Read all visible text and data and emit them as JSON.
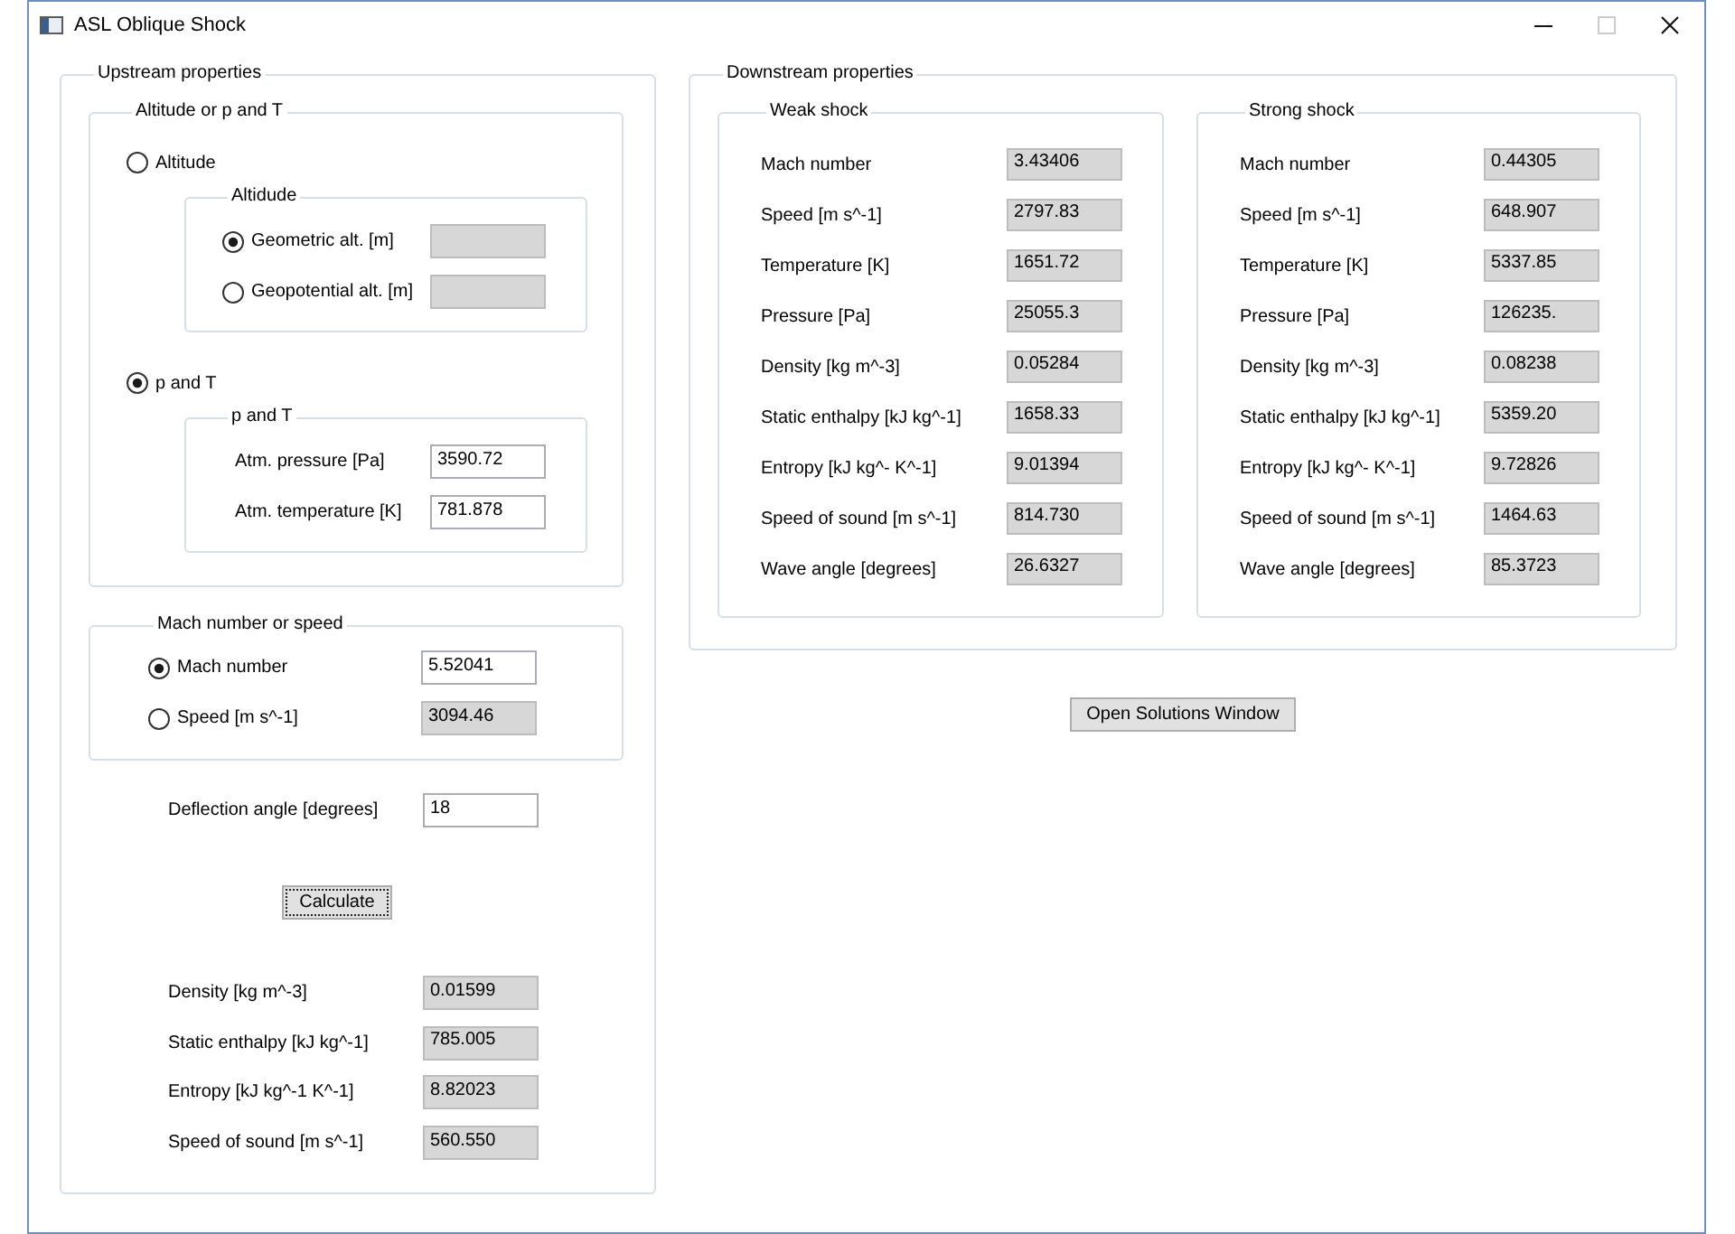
{
  "window": {
    "title": "ASL Oblique Shock",
    "maximize_disabled": true
  },
  "upstream": {
    "title": "Upstream properties",
    "source": {
      "title": "Altitude or p and T",
      "options": [
        {
          "label": "Altitude",
          "selected": false,
          "group": {
            "title": "Altidude",
            "rows": [
              {
                "kind": "radio",
                "label": "Geometric alt. [m]",
                "selected": true,
                "disabled": true
              },
              {
                "kind": "radio",
                "label": "Geopotential alt. [m]",
                "selected": false,
                "disabled": true
              }
            ]
          }
        },
        {
          "label": "p and T",
          "selected": true,
          "group": {
            "title": "p and T",
            "rows": [
              {
                "kind": "field",
                "label": "Atm. pressure [Pa]",
                "value": "3590.72",
                "disabled": false
              },
              {
                "kind": "field",
                "label": "Atm. temperature [K]",
                "value": "781.878",
                "disabled": false
              }
            ]
          }
        }
      ]
    },
    "motion": {
      "title": "Mach number or speed",
      "options": [
        {
          "label": "Mach number",
          "selected": true,
          "value": "5.52041",
          "disabled": false
        },
        {
          "label": "Speed [m s^-1]",
          "selected": false,
          "value": "3094.46",
          "disabled": true
        }
      ]
    },
    "deflection": {
      "label": "Deflection angle [degrees]",
      "value": "18"
    },
    "calculate": {
      "label": "Calculate",
      "focused": true
    },
    "results": [
      {
        "label": "Density [kg m^-3]",
        "value": "0.01599"
      },
      {
        "label": "Static enthalpy [kJ kg^-1]",
        "value": "785.005"
      },
      {
        "label": "Entropy [kJ kg^-1 K^-1]",
        "value": "8.82023"
      },
      {
        "label": "Speed of sound [m s^-1]",
        "value": "560.550"
      }
    ]
  },
  "downstream": {
    "title": "Downstream properties",
    "shocks": [
      {
        "title": "Weak shock",
        "rows": [
          {
            "label": "Mach number",
            "value": "3.43406"
          },
          {
            "label": "Speed [m s^-1]",
            "value": "2797.83"
          },
          {
            "label": "Temperature [K]",
            "value": "1651.72"
          },
          {
            "label": "Pressure [Pa]",
            "value": "25055.3"
          },
          {
            "label": "Density [kg m^-3]",
            "value": "0.05284"
          },
          {
            "label": "Static enthalpy [kJ kg^-1]",
            "value": "1658.33"
          },
          {
            "label": "Entropy [kJ kg^- K^-1]",
            "value": "9.01394"
          },
          {
            "label": "Speed of sound [m s^-1]",
            "value": "814.730"
          },
          {
            "label": "Wave angle [degrees]",
            "value": "26.6327"
          }
        ]
      },
      {
        "title": "Strong shock",
        "rows": [
          {
            "label": "Mach number",
            "value": "0.44305"
          },
          {
            "label": "Speed [m s^-1]",
            "value": "648.907"
          },
          {
            "label": "Temperature [K]",
            "value": "5337.85"
          },
          {
            "label": "Pressure [Pa]",
            "value": "126235."
          },
          {
            "label": "Density [kg m^-3]",
            "value": "0.08238"
          },
          {
            "label": "Static enthalpy [kJ kg^-1]",
            "value": "5359.20"
          },
          {
            "label": "Entropy [kJ kg^- K^-1]",
            "value": "9.72826"
          },
          {
            "label": "Speed of sound [m s^-1]",
            "value": "1464.63"
          },
          {
            "label": "Wave angle [degrees]",
            "value": "85.3723"
          }
        ]
      }
    ]
  },
  "solutions_button": {
    "label": "Open Solutions Window"
  }
}
